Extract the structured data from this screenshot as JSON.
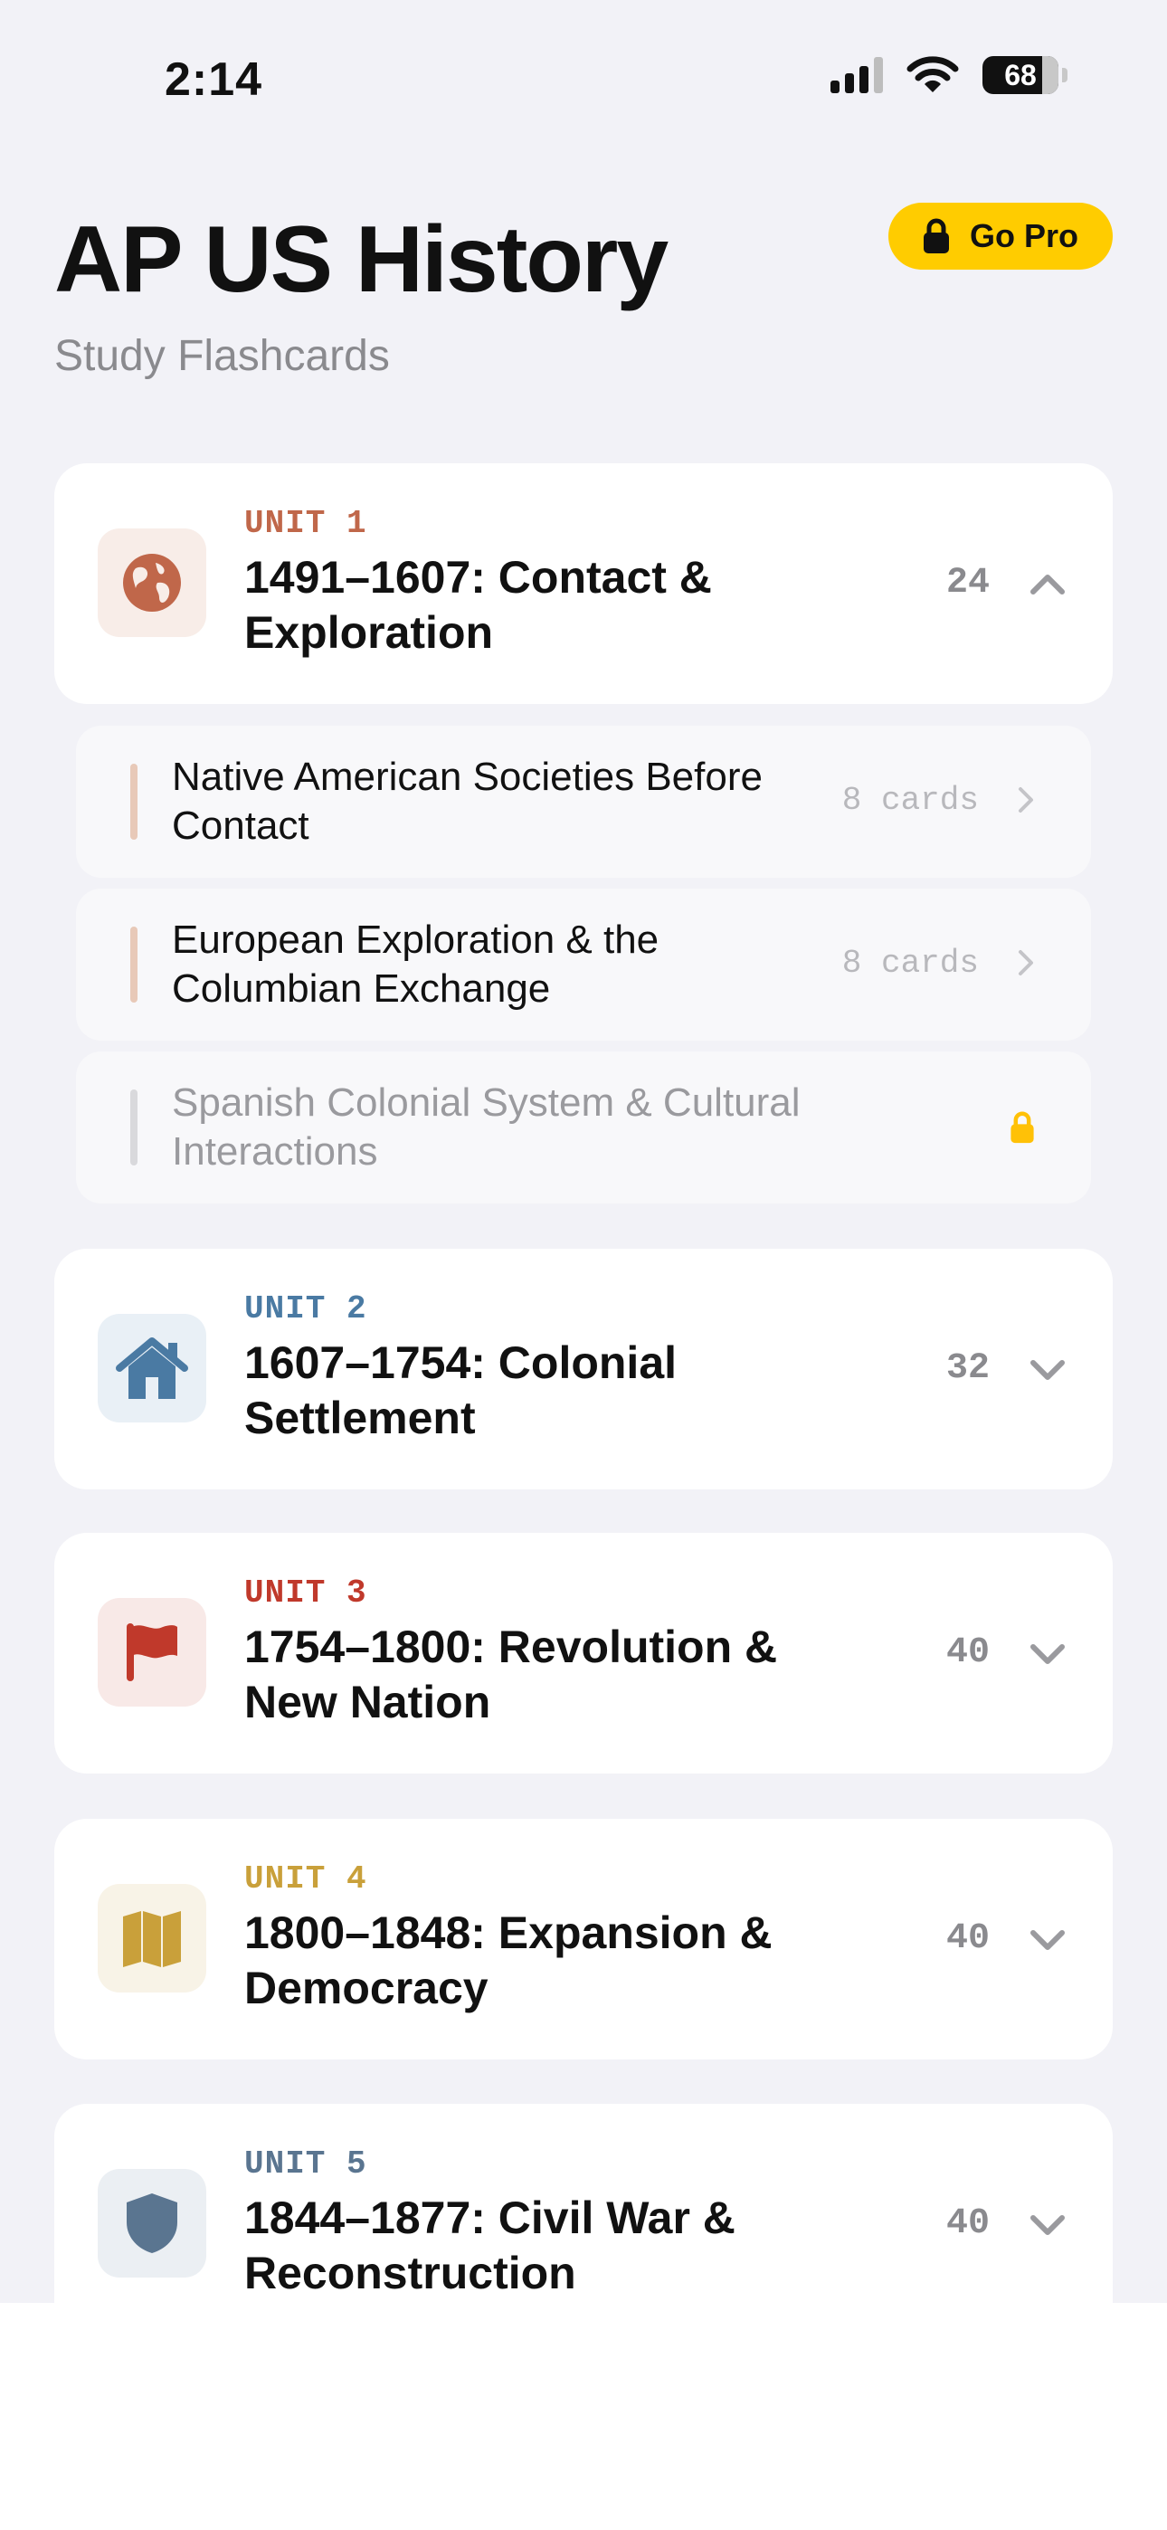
{
  "status": {
    "time": "2:14",
    "battery": "68"
  },
  "header": {
    "title": "AP US History",
    "subtitle": "Study Flashcards",
    "go_pro": "Go Pro"
  },
  "colors": {
    "unit1": "#c0674a",
    "unit2": "#4a7aa3",
    "unit3": "#c0392b",
    "unit4": "#c9a03a",
    "unit5": "#5a7590",
    "pro": "#ffcc00"
  },
  "units": [
    {
      "label": "UNIT 1",
      "title": "1491–1607: Contact & Exploration",
      "count": "24",
      "icon": "globe-icon",
      "expanded": true
    },
    {
      "label": "UNIT 2",
      "title": "1607–1754: Colonial Settlement",
      "count": "32",
      "icon": "house-icon",
      "expanded": false
    },
    {
      "label": "UNIT 3",
      "title": "1754–1800: Revolution & New Nation",
      "count": "40",
      "icon": "flag-icon",
      "expanded": false
    },
    {
      "label": "UNIT 4",
      "title": "1800–1848: Expansion & Democracy",
      "count": "40",
      "icon": "map-icon",
      "expanded": false
    },
    {
      "label": "UNIT 5",
      "title": "1844–1877: Civil War & Reconstruction",
      "count": "40",
      "icon": "shield-icon",
      "expanded": false
    }
  ],
  "topics": [
    {
      "title": "Native American Societies Before Contact",
      "count": "8 cards",
      "locked": false
    },
    {
      "title": "European Exploration & the Columbian Exchange",
      "count": "8 cards",
      "locked": false
    },
    {
      "title": "Spanish Colonial System & Cultural Interactions",
      "count": "",
      "locked": true
    }
  ]
}
